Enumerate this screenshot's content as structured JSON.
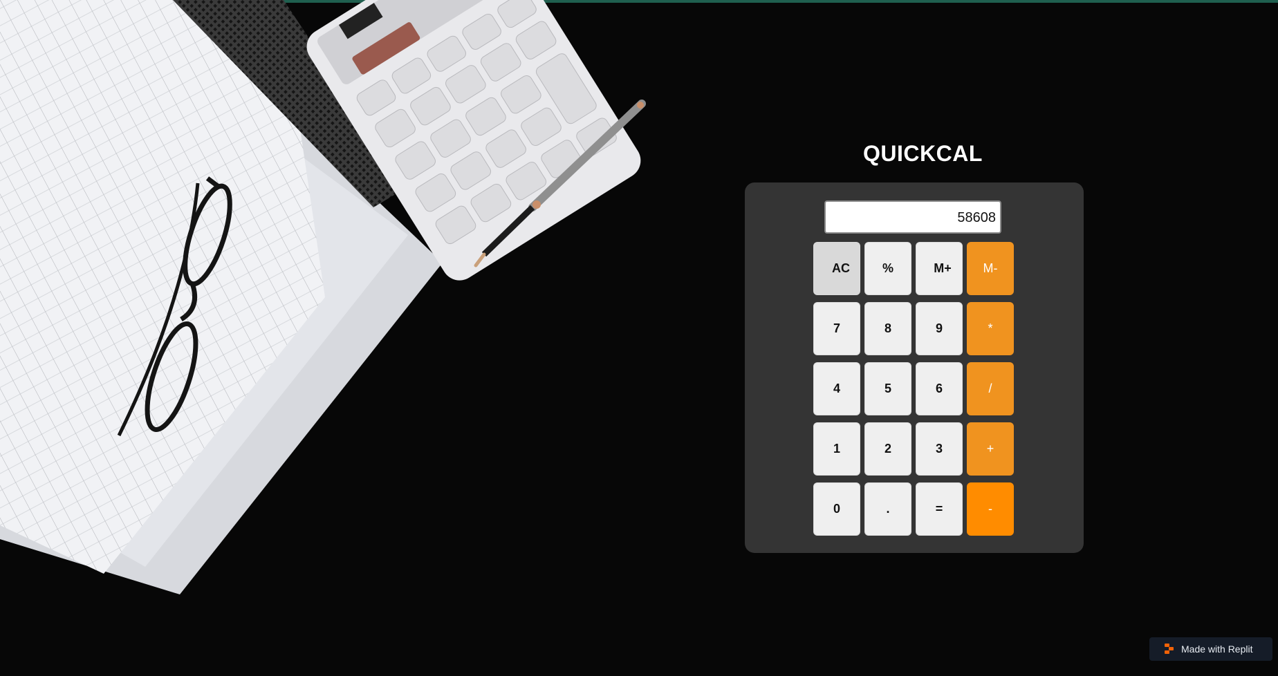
{
  "app": {
    "title": "QUICKCAL"
  },
  "display": {
    "value": "58608"
  },
  "keys": [
    {
      "label": "AC",
      "name": "clear-button"
    },
    {
      "label": "%",
      "name": "percent-button"
    },
    {
      "label": "M+",
      "name": "memory-add-button"
    },
    {
      "label": "M-",
      "name": "memory-subtract-button"
    },
    {
      "label": "7",
      "name": "digit-7-button"
    },
    {
      "label": "8",
      "name": "digit-8-button"
    },
    {
      "label": "9",
      "name": "digit-9-button"
    },
    {
      "label": "*",
      "name": "multiply-button"
    },
    {
      "label": "4",
      "name": "digit-4-button"
    },
    {
      "label": "5",
      "name": "digit-5-button"
    },
    {
      "label": "6",
      "name": "digit-6-button"
    },
    {
      "label": "/",
      "name": "divide-button"
    },
    {
      "label": "1",
      "name": "digit-1-button"
    },
    {
      "label": "2",
      "name": "digit-2-button"
    },
    {
      "label": "3",
      "name": "digit-3-button"
    },
    {
      "label": "+",
      "name": "add-button"
    },
    {
      "label": "0",
      "name": "digit-0-button"
    },
    {
      "label": ".",
      "name": "decimal-button"
    },
    {
      "label": "=",
      "name": "equals-button"
    },
    {
      "label": "-",
      "name": "subtract-button"
    }
  ],
  "badge": {
    "label": "Made with Replit",
    "icon": "replit-logo-icon"
  },
  "colors": {
    "operator": "#f0931f",
    "operator_strong": "#ff8c00",
    "panel": "#343434",
    "key": "#efefef",
    "background": "#070707"
  }
}
